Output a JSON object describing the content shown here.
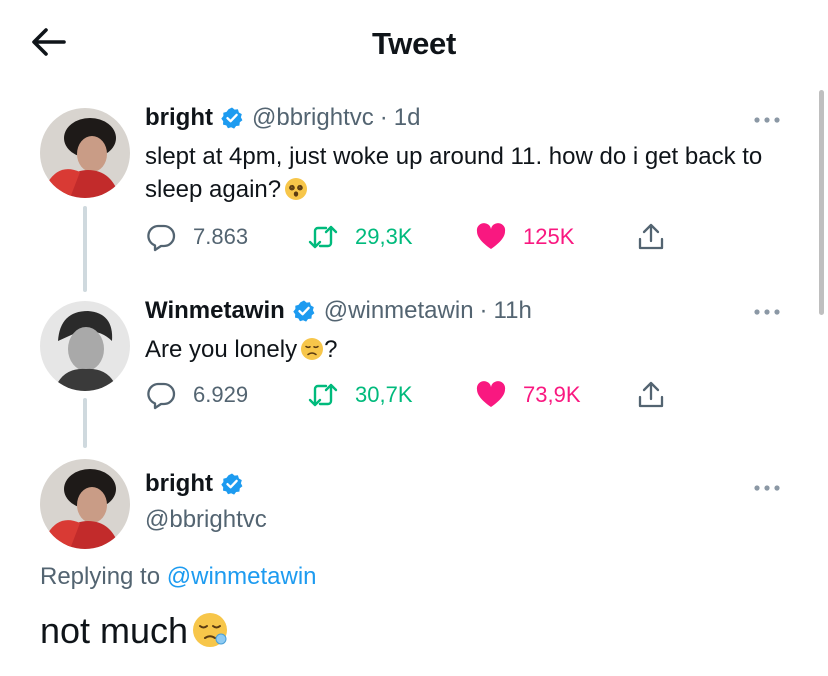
{
  "header": {
    "title": "Tweet"
  },
  "tweets": [
    {
      "display_name": "bright",
      "handle": "@bbrightvc",
      "time": "1d",
      "text": "slept at 4pm, just woke up around 11. how do i get back to sleep again?",
      "emoji": "dizzy-eyes-emoji",
      "replies": "7.863",
      "retweets": "29,3K",
      "likes": "125K"
    },
    {
      "display_name": "Winmetawin",
      "handle": "@winmetawin",
      "time": "11h",
      "text": "Are you lonely",
      "text_after": "?",
      "emoji": "disappointed-face-emoji",
      "replies": "6.929",
      "retweets": "30,7K",
      "likes": "73,9K"
    }
  ],
  "main_tweet": {
    "display_name": "bright",
    "handle": "@bbrightvc",
    "replying_prefix": "Replying to",
    "replying_to": "@winmetawin",
    "text": "not much",
    "emoji": "sleepy-face-emoji"
  },
  "colors": {
    "verified": "#1d9bf0",
    "retweet": "#00ba7c",
    "like": "#f91880",
    "secondary_text": "#536471",
    "link": "#1d9bf0"
  }
}
